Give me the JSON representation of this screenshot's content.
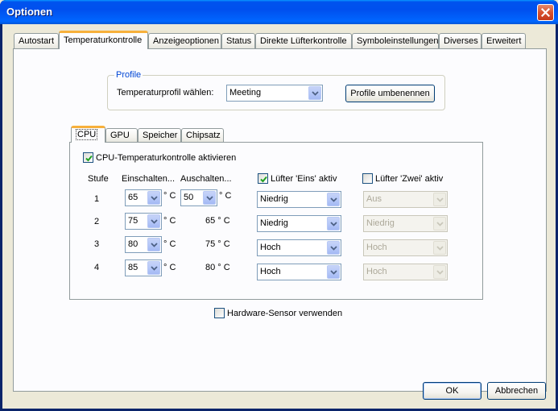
{
  "window": {
    "title": "Optionen"
  },
  "tabs": [
    {
      "label": "Autostart"
    },
    {
      "label": "Temperaturkontrolle"
    },
    {
      "label": "Anzeigeoptionen"
    },
    {
      "label": "Status"
    },
    {
      "label": "Direkte Lüfterkontrolle"
    },
    {
      "label": "Symboleinstellungen"
    },
    {
      "label": "Diverses"
    },
    {
      "label": "Erweitert"
    }
  ],
  "profile": {
    "group_label": "Profile",
    "select_label": "Temperaturprofil wählen:",
    "selected": "Meeting",
    "rename_button": "Profile umbenennen"
  },
  "inner_tabs": [
    {
      "label": "CPU"
    },
    {
      "label": "GPU"
    },
    {
      "label": "Speicher"
    },
    {
      "label": "Chipsatz"
    }
  ],
  "cpu": {
    "enable_label": "CPU-Temperaturkontrolle aktivieren",
    "enable_checked": true,
    "headers": {
      "stufe": "Stufe",
      "einschalten": "Einschalten...",
      "ausschalten": "Auschalten..."
    },
    "fan1": {
      "label": "Lüfter 'Eins' aktiv",
      "checked": true
    },
    "fan2": {
      "label": "Lüfter 'Zwei' aktiv",
      "checked": false
    },
    "unit": "° C",
    "rows": [
      {
        "stufe": "1",
        "on": "65",
        "off": "50",
        "off_editable": true,
        "fan1": "Niedrig",
        "fan2": "Aus"
      },
      {
        "stufe": "2",
        "on": "75",
        "off": "65 ° C",
        "off_editable": false,
        "fan1": "Niedrig",
        "fan2": "Niedrig"
      },
      {
        "stufe": "3",
        "on": "80",
        "off": "75 ° C",
        "off_editable": false,
        "fan1": "Hoch",
        "fan2": "Hoch"
      },
      {
        "stufe": "4",
        "on": "85",
        "off": "80 ° C",
        "off_editable": false,
        "fan1": "Hoch",
        "fan2": "Hoch"
      }
    ]
  },
  "hardware_sensor": {
    "label": "Hardware-Sensor verwenden",
    "checked": false
  },
  "buttons": {
    "ok": "OK",
    "cancel": "Abbrechen"
  }
}
